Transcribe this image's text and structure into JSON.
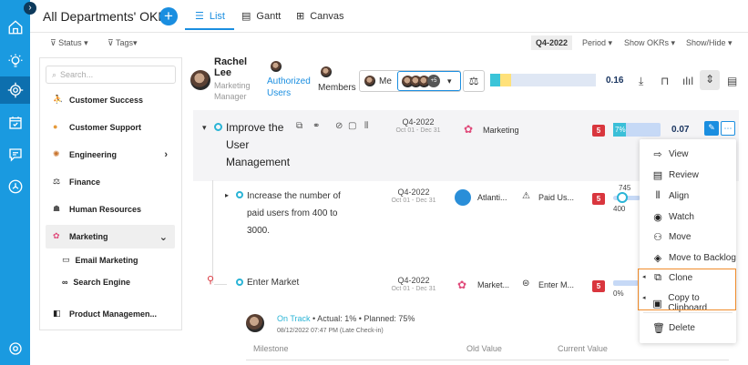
{
  "header": {
    "title": "All Departments' OKRs",
    "tabs": [
      {
        "label": "List",
        "active": true
      },
      {
        "label": "Gantt",
        "active": false
      },
      {
        "label": "Canvas",
        "active": false
      }
    ]
  },
  "filters": {
    "status": "Status",
    "tags": "Tags",
    "quarter": "Q4-2022",
    "period": "Period",
    "show_okrs": "Show OKRs",
    "show_hide": "Show/Hide"
  },
  "sidebar": {
    "search_placeholder": "Search...",
    "departments": [
      {
        "label": "Customer Success"
      },
      {
        "label": "Customer Support"
      },
      {
        "label": "Engineering"
      },
      {
        "label": "Finance"
      },
      {
        "label": "Human Resources"
      },
      {
        "label": "Marketing"
      },
      {
        "label": "Product Managemen..."
      }
    ],
    "marketing_sub": [
      {
        "label": "Email Marketing"
      },
      {
        "label": "Search Engine"
      }
    ]
  },
  "owner": {
    "name": "Rachel Lee",
    "role": "Marketing Manager",
    "authorized_users": "Authorized Users",
    "members": "Members",
    "me": "Me",
    "more_count": "+5",
    "score": "0.16"
  },
  "okr": {
    "title": "Improve the User Management",
    "period": "Q4-2022",
    "dates": "Oct 01 - Dec 31",
    "team": "Marketing",
    "badge": "5",
    "progress": "7%",
    "progress_value": 7,
    "score": "0.07"
  },
  "kr1": {
    "text": "Increase the number of paid users from 400 to 3000.",
    "period": "Q4-2022",
    "dates": "Oct 01 - Dec 31",
    "team": "Atlanti...",
    "metric": "Paid Us...",
    "badge": "5",
    "slider_top": "745",
    "slider_left": "400"
  },
  "kr2": {
    "text": "Enter Market",
    "period": "Q4-2022",
    "dates": "Oct 01 - Dec 31",
    "team": "Market...",
    "metric": "Enter M...",
    "badge": "5",
    "progress": "0%"
  },
  "checkin": {
    "status": "On Track",
    "actual": "• Actual: 1%",
    "planned": "• Planned: 75%",
    "date": "08/12/2022 07:47 PM",
    "note": "(Late Check-in)"
  },
  "table_headers": [
    "Milestone",
    "Old Value",
    "Current Value"
  ],
  "context_menu": {
    "items": [
      {
        "label": "View"
      },
      {
        "label": "Review"
      },
      {
        "label": "Align"
      },
      {
        "label": "Watch"
      },
      {
        "label": "Move"
      },
      {
        "label": "Move to Backlog"
      },
      {
        "label": "Clone"
      },
      {
        "label": "Copy to Clipboard"
      },
      {
        "label": "Delete"
      }
    ]
  }
}
